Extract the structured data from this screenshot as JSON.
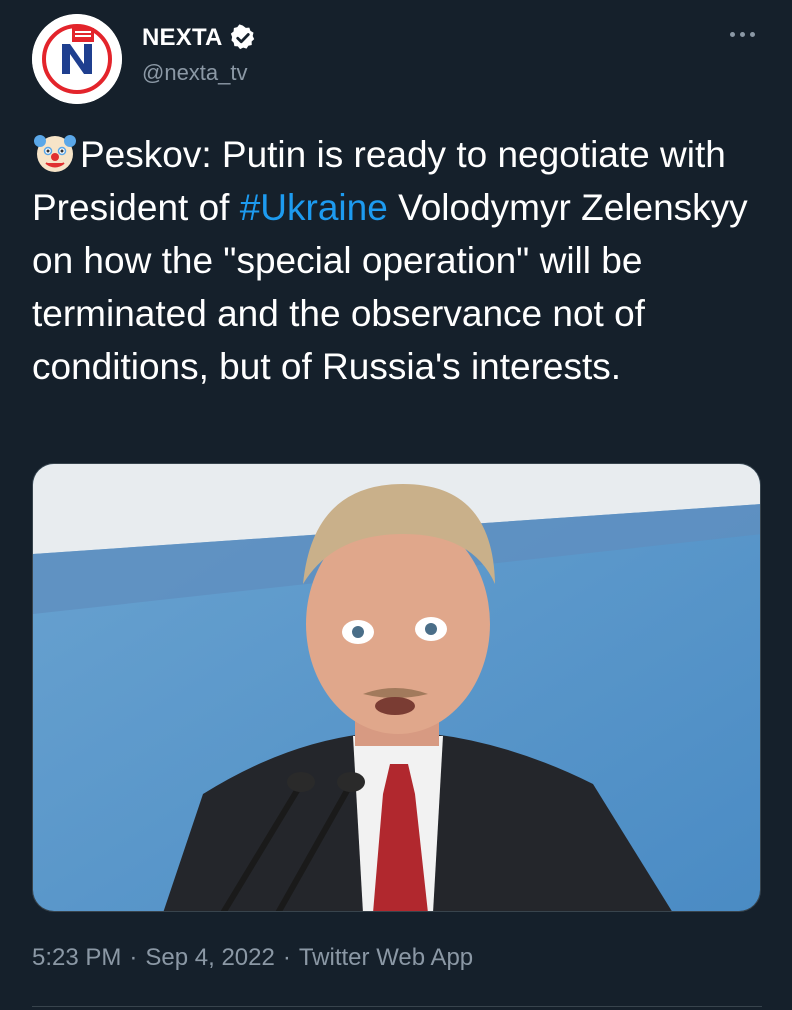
{
  "author": {
    "display_name": "NEXTA",
    "handle": "@nexta_tv",
    "verified": true,
    "avatar_icon": "nexta-logo-icon"
  },
  "tweet": {
    "emoji": "clown-face-emoji",
    "text_part1": "Peskov: Putin is ready to negotiate with President of ",
    "hashtag": "#Ukraine",
    "text_part2": " Volodymyr Zelenskyy on how the \"special operation\" will be terminated and the observance not of conditions, but of Russia's interests."
  },
  "meta": {
    "time": "5:23 PM",
    "separator": "·",
    "date": "Sep 4, 2022",
    "source": "Twitter Web App"
  },
  "colors": {
    "background": "#15202b",
    "link": "#1d9bf0",
    "secondary_text": "#8b98a5"
  }
}
